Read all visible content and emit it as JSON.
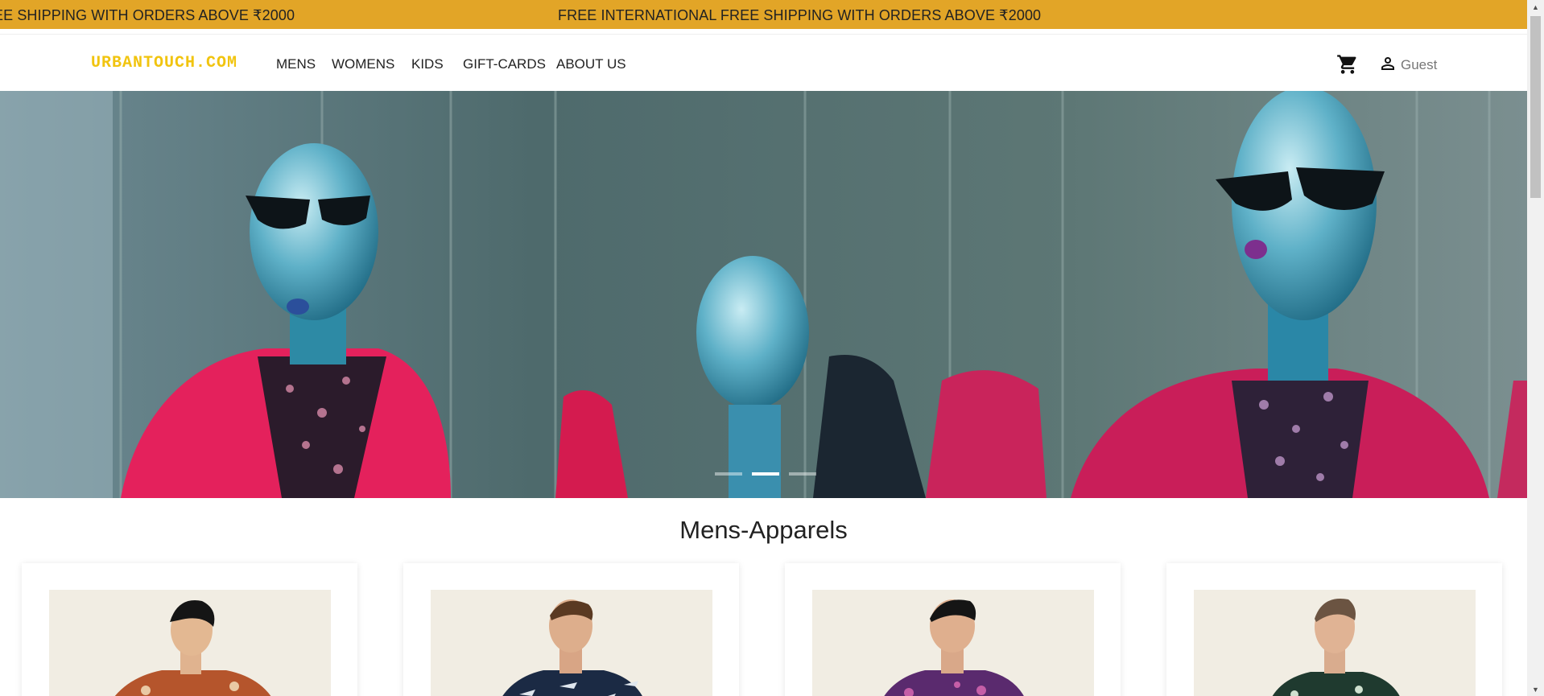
{
  "announcement": {
    "marquee_left": "EE SHIPPING WITH ORDERS ABOVE ₹2000",
    "marquee_right": "FREE INTERNATIONAL FREE SHIPPING WITH ORDERS ABOVE ₹2000",
    "bg_color": "#e2a527"
  },
  "nav": {
    "logo": "URBANTOUCH.COM",
    "logo_color": "#f1c40f",
    "links": [
      "MENS",
      "WOMENS",
      "KIDS",
      "GIFT-CARDS",
      "ABOUT US"
    ],
    "cart_icon": "shopping-cart-icon",
    "user_icon": "person-icon",
    "user_label": "Guest"
  },
  "hero": {
    "slide_count": 3,
    "active_slide": 2
  },
  "section": {
    "title": "Mens-Apparels"
  },
  "products": [
    {
      "shirt_color": "#b5552c",
      "pattern": "floral"
    },
    {
      "shirt_color": "#1b2a44",
      "pattern": "shark print"
    },
    {
      "shirt_color": "#5a2a6e",
      "pattern": "paisley"
    },
    {
      "shirt_color": "#1f3a2f",
      "pattern": "leaf print"
    }
  ]
}
